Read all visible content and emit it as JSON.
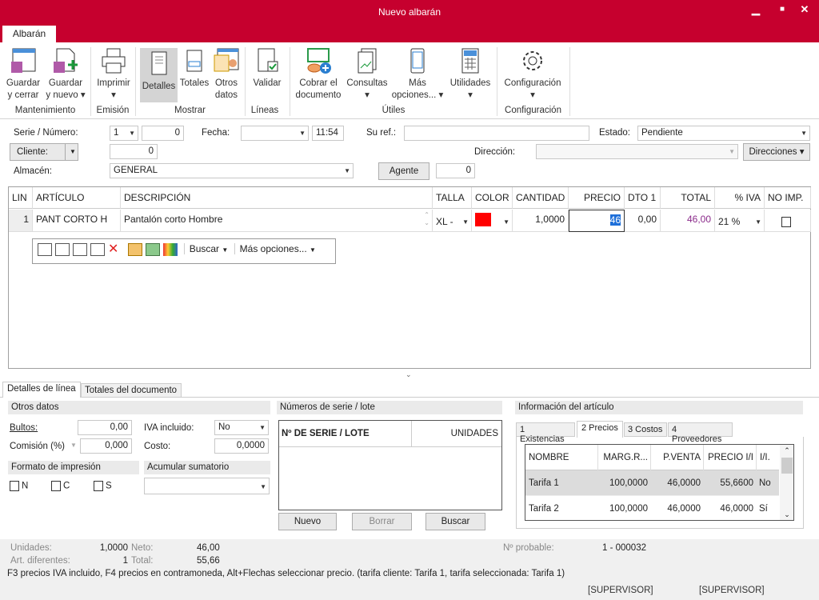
{
  "window": {
    "title": "Nuevo albarán",
    "minimize": "▁",
    "maximize": "■",
    "close": "✕"
  },
  "ribbon": {
    "tab": "Albarán",
    "buttons": [
      {
        "l1": "Guardar",
        "l2": "y cerrar"
      },
      {
        "l1": "Guardar",
        "l2": "y nuevo ▾"
      },
      {
        "l1": "Imprimir",
        "l2": "▾"
      },
      {
        "l1": "Detalles",
        "l2": ""
      },
      {
        "l1": "Totales",
        "l2": ""
      },
      {
        "l1": "Otros",
        "l2": "datos"
      },
      {
        "l1": "Validar",
        "l2": ""
      },
      {
        "l1": "Cobrar el",
        "l2": "documento"
      },
      {
        "l1": "Consultas",
        "l2": "▾"
      },
      {
        "l1": "Más",
        "l2": "opciones... ▾"
      },
      {
        "l1": "Utilidades",
        "l2": "▾"
      },
      {
        "l1": "Configuración",
        "l2": "▾"
      }
    ],
    "groups": [
      "Mantenimiento",
      "Emisión",
      "Mostrar",
      "Líneas",
      "Útiles",
      "Configuración"
    ]
  },
  "form": {
    "serie_label": "Serie / Número:",
    "serie": "1",
    "numero": "0",
    "fecha_label": "Fecha:",
    "fecha": "",
    "hora": "11:54",
    "suref_label": "Su ref.:",
    "suref": "",
    "estado_label": "Estado:",
    "estado": "Pendiente",
    "cliente_btn": "Cliente:",
    "cliente": "0",
    "direccion_label": "Dirección:",
    "direccion": "",
    "direcciones_btn": "Direcciones ▾",
    "almacen_label": "Almacén:",
    "almacen": "GENERAL",
    "agente_btn": "Agente",
    "agente": "0"
  },
  "grid": {
    "headers": [
      "LIN",
      "ARTÍCULO",
      "DESCRIPCIÓN",
      "TALLA",
      "COLOR",
      "CANTIDAD",
      "PRECIO",
      "DTO 1",
      "TOTAL",
      "% IVA",
      "NO IMP."
    ],
    "rows": [
      {
        "lin": "1",
        "articulo": "PANT CORTO H",
        "descripcion": "Pantalón corto Hombre",
        "talla": "XL -",
        "color": "#ff0000",
        "cantidad": "1,0000",
        "precio": "46",
        "dto": "0,00",
        "total": "46,00",
        "iva": "21 %",
        "noimp": false
      }
    ],
    "toolbar": {
      "buscar": "Buscar",
      "mas": "Más opciones..."
    }
  },
  "bottom_tabs": [
    "Detalles de línea",
    "Totales del documento"
  ],
  "otros": {
    "title": "Otros datos",
    "bultos_label": "Bultos:",
    "bultos": "0,00",
    "iva_label": "IVA incluido:",
    "iva": "No",
    "comision_label": "Comisión (%)",
    "comision": "0,000",
    "costo_label": "Costo:",
    "costo": "0,0000",
    "formato_title": "Formato de impresión",
    "acumular_title": "Acumular sumatorio",
    "checks": [
      "N",
      "C",
      "S"
    ]
  },
  "serie": {
    "title": "Números de serie / lote",
    "col1": "Nº DE SERIE / LOTE",
    "col2": "UNIDADES",
    "nuevo": "Nuevo",
    "borrar": "Borrar",
    "buscar": "Buscar"
  },
  "info": {
    "title": "Información del artículo",
    "tabs": [
      "1 Existencias",
      "2 Precios",
      "3 Costos",
      "4 Proveedores"
    ],
    "headers": [
      "NOMBRE",
      "MARG.R...",
      "P.VENTA",
      "PRECIO I/I",
      "I/I."
    ],
    "rows": [
      [
        "Tarifa 1",
        "100,0000",
        "46,0000",
        "55,6600",
        "No"
      ],
      [
        "Tarifa 2",
        "100,0000",
        "46,0000",
        "46,0000",
        "Sí"
      ]
    ]
  },
  "status": {
    "unidades_label": "Unidades:",
    "unidades": "1,0000",
    "neto_label": "Neto:",
    "neto": "46,00",
    "art_label": "Art. diferentes:",
    "art": "1",
    "total_label": "Total:",
    "total": "55,66",
    "nprob_label": "Nº probable:",
    "nprob": "1 - 000032",
    "hint": "F3 precios IVA incluido, F4 precios en contramoneda, Alt+Flechas seleccionar precio. (tarifa cliente: Tarifa 1, tarifa seleccionada: Tarifa 1)",
    "user1": "[SUPERVISOR]",
    "user2": "[SUPERVISOR]"
  }
}
